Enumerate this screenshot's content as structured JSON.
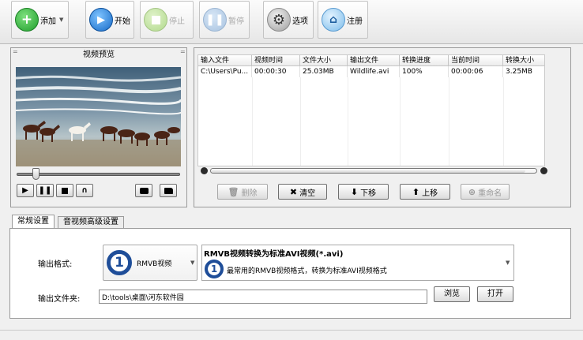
{
  "toolbar": {
    "add_label": "添加",
    "start_label": "开始",
    "stop_label": "停止",
    "pause_label": "暂停",
    "options_label": "选项",
    "register_label": "注册"
  },
  "preview": {
    "title": "视频预览",
    "seek_progress": 0.12
  },
  "file_list": {
    "columns": [
      "输入文件",
      "视频时间",
      "文件大小",
      "输出文件",
      "转换进度",
      "当前时间",
      "转换大小"
    ],
    "rows": [
      [
        "C:\\Users\\Pu...",
        "00:00:30",
        "25.03MB",
        "Wildlife.avi",
        "100%",
        "00:00:06",
        "3.25MB"
      ]
    ]
  },
  "list_actions": {
    "delete_label": "删除",
    "clear_label": "清空",
    "move_down_label": "下移",
    "move_up_label": "上移",
    "rename_label": "重命名"
  },
  "tabs": {
    "general": "常规设置",
    "advanced": "音视频高级设置"
  },
  "settings": {
    "output_format_label": "输出格式:",
    "format_badge": "1",
    "format_name": "RMVB视频",
    "format_title": "RMVB视频转换为标准AVI视频(*.avi)",
    "format_description": "最常用的RMVB视频格式，转换为标准AVI视频格式",
    "output_folder_label": "输出文件夹:",
    "output_folder_value": "D:\\tools\\桌面\\河东软件园",
    "browse_label": "浏览",
    "open_label": "打开"
  },
  "colors": {
    "accent_blue": "#1f4e99",
    "add_green": "#1e9e2b",
    "start_blue": "#1569c7"
  }
}
